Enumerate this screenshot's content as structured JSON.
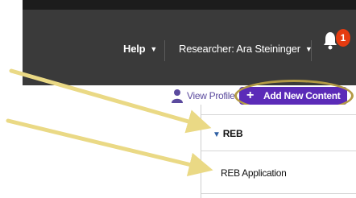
{
  "topbar": {
    "help_label": "Help",
    "researcher_label": "Researcher: Ara Steininger",
    "notification_count": "1"
  },
  "profile": {
    "view_profile_label": "View Profile"
  },
  "add_button": {
    "label": "Add New Content",
    "icon": "plus-icon"
  },
  "dropdown": {
    "section_header": "REB",
    "items": [
      {
        "label": "REB Application"
      }
    ]
  },
  "annotations": {
    "arrow_color": "#ead985",
    "highlight_color": "#b39a45",
    "accent_color": "#5b2bb8"
  }
}
